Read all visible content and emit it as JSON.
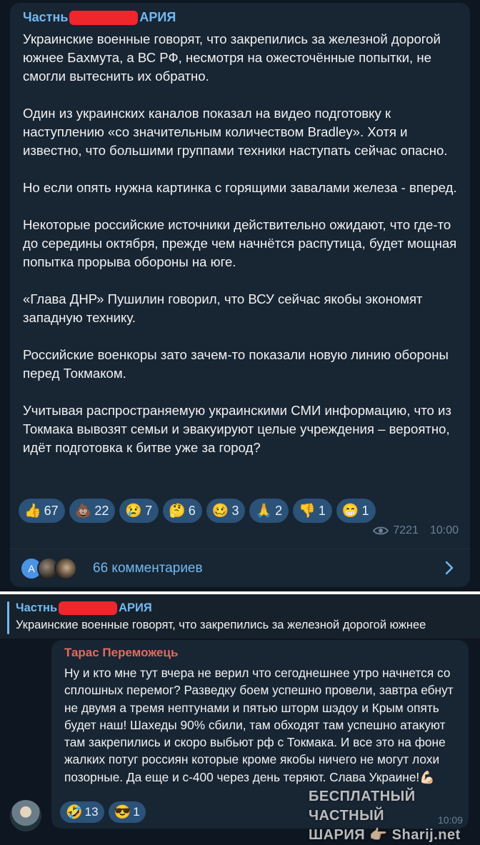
{
  "post": {
    "channel_prefix": "Частнь",
    "channel_suffix": "АРИЯ",
    "paragraphs": [
      "Украинские военные говорят, что закрепились за железной дорогой южнее Бахмута, а ВС РФ, несмотря на ожесточённые попытки, не смогли вытеснить их обратно.",
      "Один из украинских каналов показал на видео подготовку к наступлению «со значительным количеством Bradley». Хотя и известно, что большими группами техники наступать сейчас опасно.",
      "Но если опять нужна картинка с горящими завалами железа - вперед.",
      "Некоторые российские источники действительно ожидают, что где-то до середины октября, прежде чем начнётся распутица, будет мощная попытка прорыва обороны на юге.",
      "«Глава ДНР» Пушилин говорил, что ВСУ сейчас якобы экономят западную технику.",
      "Российские военкоры зато зачем-то показали новую линию обороны перед Токмаком.",
      "Учитывая распространяемую украинскими СМИ информацию, что из Токмака вывозят семьи и эвакуируют целые учреждения – вероятно, идёт подготовка к битве уже за город?"
    ],
    "reactions": [
      {
        "emoji": "👍",
        "count": "67"
      },
      {
        "emoji": "💩",
        "count": "22"
      },
      {
        "emoji": "😢",
        "count": "7"
      },
      {
        "emoji": "🤔",
        "count": "6"
      },
      {
        "emoji": "🥴",
        "count": "3"
      },
      {
        "emoji": "🙏",
        "count": "2"
      },
      {
        "emoji": "👎",
        "count": "1"
      },
      {
        "emoji": "😁",
        "count": "1"
      }
    ],
    "views": "7221",
    "time": "10:00",
    "comments_label": "66 комментариев",
    "avatar_letter": "A"
  },
  "reply": {
    "channel_prefix": "Частнь",
    "channel_suffix": "АРИЯ",
    "quoted_text": "Украинские военные говорят, что закрепились за железной дорогой южнее"
  },
  "comment": {
    "author": "Тарас Переможець",
    "text": "Ну и кто мне тут вчера не верил что сегоднешнее утро начнется со сплошных перемог? Разведку боем успешно провели, завтра ебнут не двумя а тремя нептунами и пятью шторм шэдоу и Крым опять будет наш! Шахеды 90% сбили, там обходят там успешно атакуют там закрепились и скоро выбьют рф с Токмака. И все это на фоне жалких потуг россиян которые кроме якобы ничего не могут лохи позорные. Да еще и с-400 через день теряют. Слава Украине!💪🏻",
    "reactions": [
      {
        "emoji": "🤣",
        "count": "13"
      },
      {
        "emoji": "😎",
        "count": "1"
      }
    ],
    "time": "10:09"
  },
  "watermark": {
    "line1": "БЕСПЛАТНЫЙ ЧАСТНЫЙ",
    "line2": "ШАРИЯ 👉🏻 Sharij.net"
  },
  "colors": {
    "accent": "#71baf2",
    "bubble": "#182533",
    "background": "#0e1621",
    "reaction": "#2b5278",
    "author": "#e5695e",
    "redaction": "#f0262d"
  }
}
